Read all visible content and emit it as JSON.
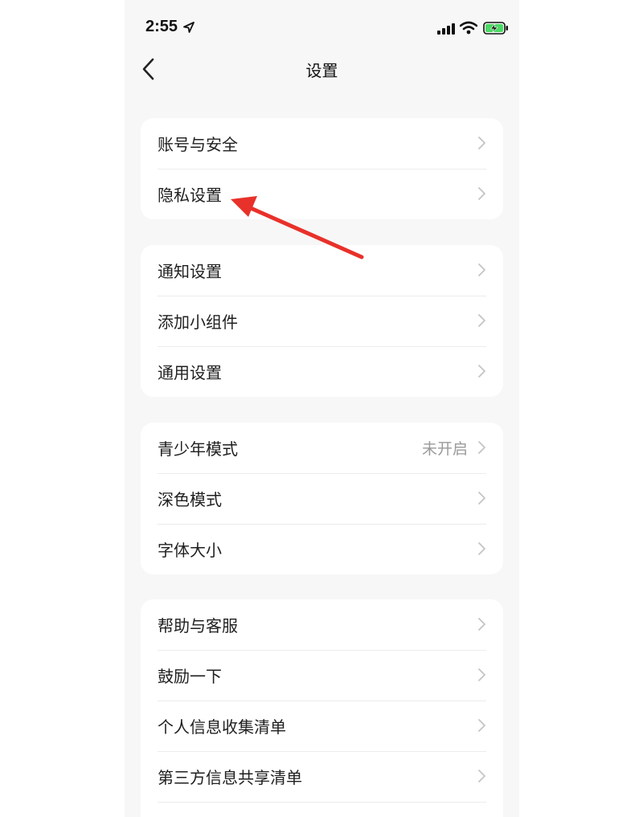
{
  "status_bar": {
    "time": "2:55"
  },
  "nav": {
    "title": "设置"
  },
  "groups": [
    {
      "items": [
        {
          "label": "账号与安全",
          "value": ""
        },
        {
          "label": "隐私设置",
          "value": ""
        }
      ]
    },
    {
      "items": [
        {
          "label": "通知设置",
          "value": ""
        },
        {
          "label": "添加小组件",
          "value": ""
        },
        {
          "label": "通用设置",
          "value": ""
        }
      ]
    },
    {
      "items": [
        {
          "label": "青少年模式",
          "value": "未开启"
        },
        {
          "label": "深色模式",
          "value": ""
        },
        {
          "label": "字体大小",
          "value": ""
        }
      ]
    },
    {
      "items": [
        {
          "label": "帮助与客服",
          "value": ""
        },
        {
          "label": "鼓励一下",
          "value": ""
        },
        {
          "label": "个人信息收集清单",
          "value": ""
        },
        {
          "label": "第三方信息共享清单",
          "value": ""
        }
      ]
    }
  ],
  "icons": {
    "back": "chevron-left-icon",
    "row": "chevron-right-icon",
    "annotation": "red-arrow-icon"
  },
  "colors": {
    "background": "#f7f7f7",
    "card": "#ffffff",
    "annotation": "#e8312a",
    "battery": "#4cd964"
  }
}
